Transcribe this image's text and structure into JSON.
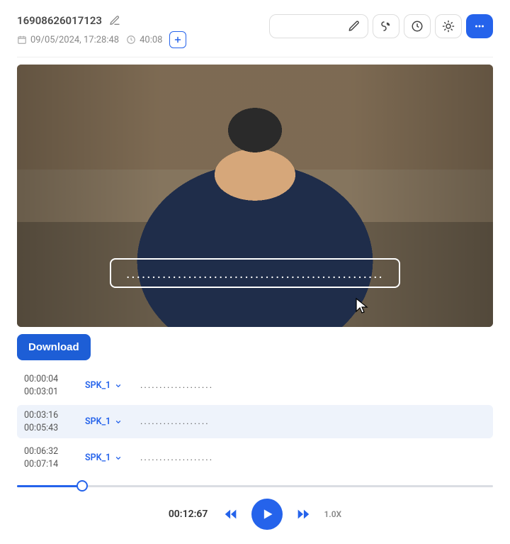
{
  "header": {
    "doc_id": "16908626017123",
    "date": "09/05/2024, 17:28:48",
    "duration": "40:08"
  },
  "caption_placeholder": "..................................................",
  "actions": {
    "download": "Download"
  },
  "segments": [
    {
      "start": "00:00:04",
      "end": "00:03:01",
      "speaker": "SPK_1",
      "text": "...................",
      "selected": false
    },
    {
      "start": "00:03:16",
      "end": "00:05:43",
      "speaker": "SPK_1",
      "text": "..................",
      "selected": true
    },
    {
      "start": "00:06:32",
      "end": "00:07:14",
      "speaker": "SPK_1",
      "text": "...................",
      "selected": false
    }
  ],
  "player": {
    "current_time": "00:12:67",
    "rate": "1.0X"
  }
}
